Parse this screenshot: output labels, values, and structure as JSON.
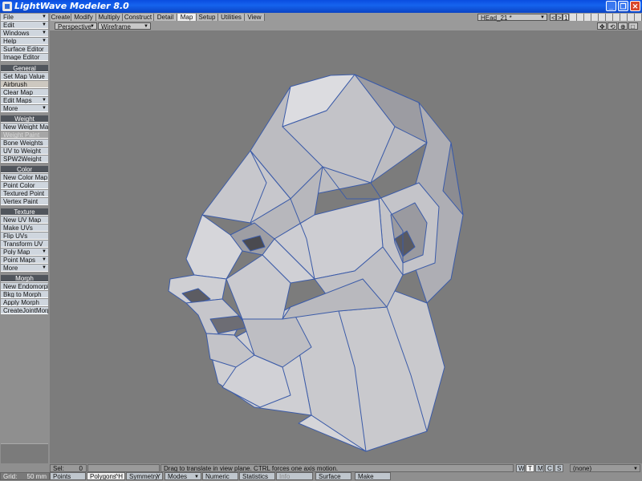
{
  "window": {
    "title": "LightWave Modeler 8.0",
    "minimize": "_",
    "maximize": "❐",
    "close": "✕"
  },
  "tabs": [
    "Create",
    "Modify",
    "Multiply",
    "Construct",
    "Detail",
    "Map",
    "Setup",
    "Utilities",
    "View"
  ],
  "active_tab": "Map",
  "top_right": {
    "object_name": "HEad_21 *",
    "prev": "<",
    "next": ">",
    "layer_num": "1"
  },
  "view": {
    "mode": "Perspective",
    "shading": "Wireframe Shade",
    "icons": [
      "✥",
      "⟲",
      "⊕",
      "□"
    ]
  },
  "sidebar": {
    "top_items": [
      "File",
      "Edit",
      "Windows",
      "Help",
      "Surface Editor",
      "Image Editor"
    ],
    "groups": [
      {
        "header": "General",
        "items": [
          "Set Map Value",
          "Airbrush",
          "Clear Map",
          "Edit Maps",
          "More"
        ]
      },
      {
        "header": "Weight",
        "items": [
          "New Weight Map",
          "Weight Paint",
          "Bone Weights",
          "UV to Weight",
          "SPW2Weight"
        ]
      },
      {
        "header": "Color",
        "items": [
          "New Color Map",
          "Point Color",
          "Textured Point",
          "Vertex Paint"
        ]
      },
      {
        "header": "Texture",
        "items": [
          "New UV Map",
          "Make UVs",
          "Flip UVs",
          "Transform UV",
          "Poly Map",
          "Point Maps",
          "More"
        ]
      },
      {
        "header": "Morph",
        "items": [
          "New Endomorph",
          "Bkg to Morph",
          "Apply Morph",
          "CreateJointMorph"
        ]
      }
    ]
  },
  "status": {
    "sel_label": "Sel:",
    "sel_value": "0",
    "hint": "Drag to translate in view plane. CTRL forces one axis motion.",
    "map_buttons": [
      "W",
      "T",
      "M",
      "C",
      "S"
    ],
    "map_select": "(none)",
    "grid_label": "Grid:",
    "grid_value": "50 mm",
    "bottom": [
      "Points",
      "Polygons",
      "Symmetry",
      "Modes",
      "Numeric",
      "Statistics",
      "Info",
      "Surface",
      "Make"
    ],
    "polygons_suffix": "^H",
    "symmetry_suffix": "Y"
  }
}
